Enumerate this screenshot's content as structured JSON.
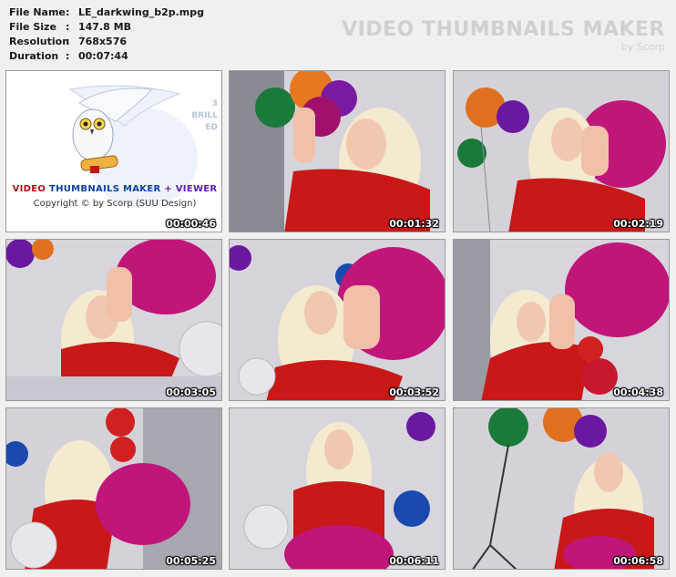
{
  "info": {
    "file_name_label": "File Name",
    "file_name": "LE_darkwing_b2p.mpg",
    "file_size_label": "File Size",
    "file_size": "147.8 MB",
    "resolution_label": "Resolution",
    "resolution": "768x576",
    "duration_label": "Duration",
    "duration": "00:07:44",
    "colon": ":"
  },
  "brand": {
    "title": "VIDEO THUMBNAILS MAKER",
    "subtitle": "by Scorp"
  },
  "logo": {
    "title_part1": "VIDEO",
    "title_part2": "THUMBNAILS MAKER",
    "title_part3": "+ VIEWER",
    "copyright": "Copyright © by Scorp (SUU Design)",
    "side_1": "3",
    "side_2": "BRILL",
    "side_3": "ED"
  },
  "thumbnails": [
    {
      "time": "00:00:46"
    },
    {
      "time": "00:01:32"
    },
    {
      "time": "00:02:19"
    },
    {
      "time": "00:03:05"
    },
    {
      "time": "00:03:52"
    },
    {
      "time": "00:04:38"
    },
    {
      "time": "00:05:25"
    },
    {
      "time": "00:06:11"
    },
    {
      "time": "00:06:58"
    }
  ],
  "colors": {
    "balloon_magenta": "#c0167a",
    "shirt_red": "#d01818",
    "hair_blonde": "#f2e6c4",
    "wall_gray": "#d8d8dc"
  }
}
